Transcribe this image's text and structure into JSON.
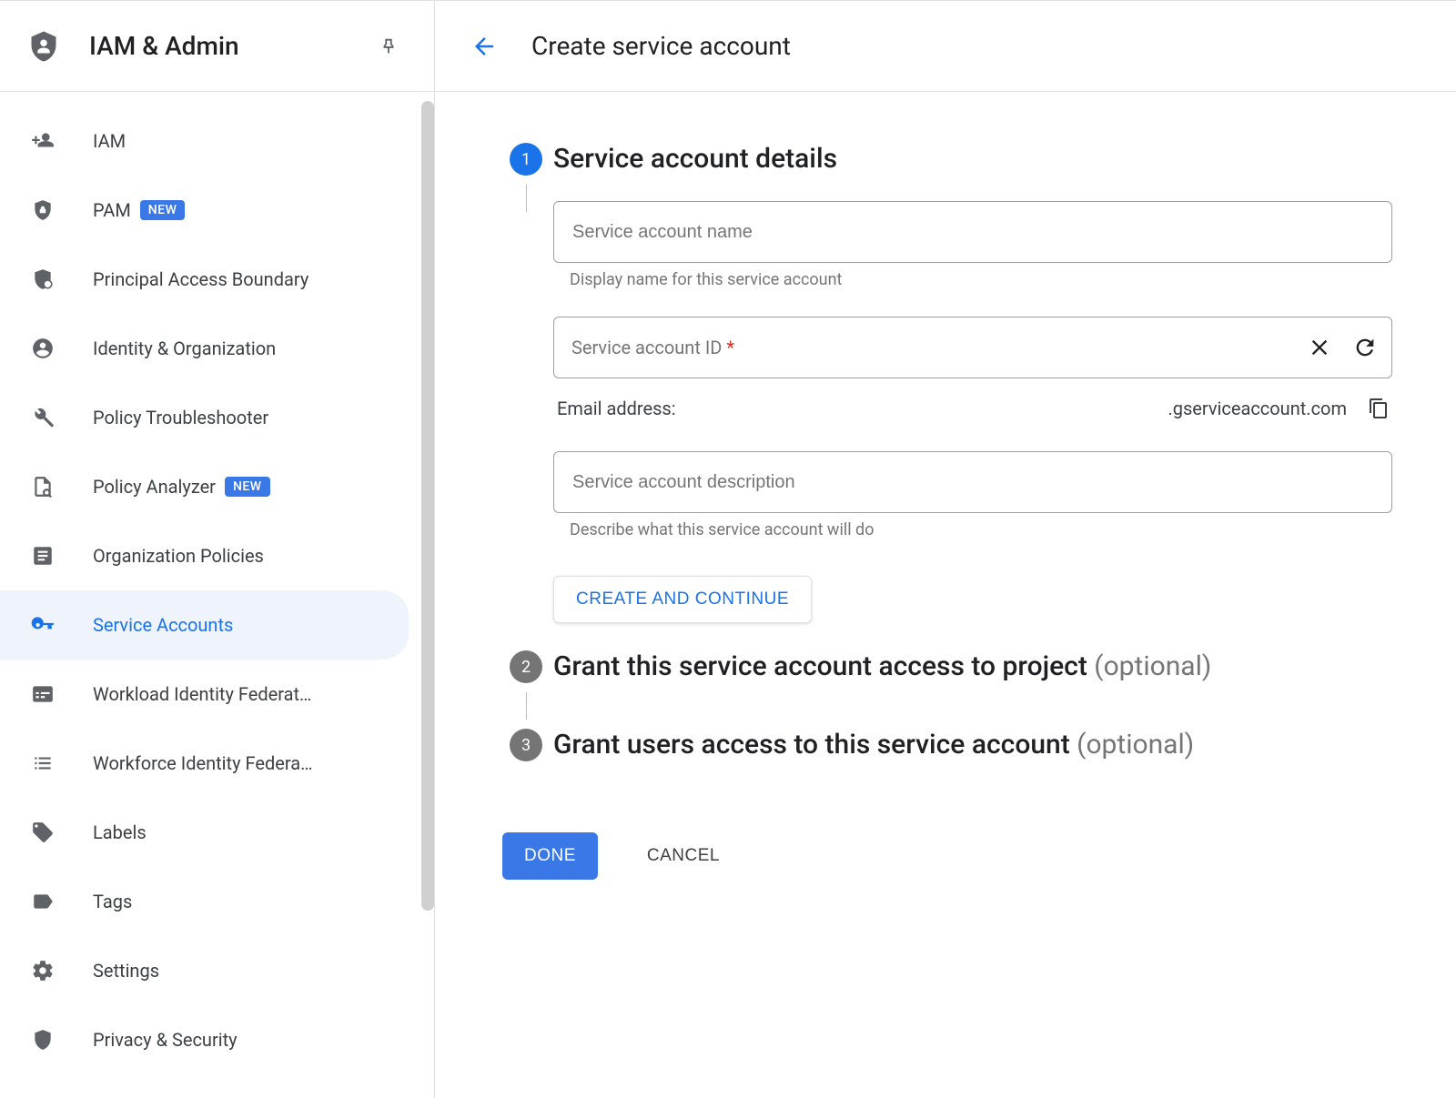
{
  "sidebar": {
    "product_title": "IAM & Admin",
    "items": [
      {
        "label": "IAM",
        "badge": null
      },
      {
        "label": "PAM",
        "badge": "NEW"
      },
      {
        "label": "Principal Access Boundary",
        "badge": null
      },
      {
        "label": "Identity & Organization",
        "badge": null
      },
      {
        "label": "Policy Troubleshooter",
        "badge": null
      },
      {
        "label": "Policy Analyzer",
        "badge": "NEW"
      },
      {
        "label": "Organization Policies",
        "badge": null
      },
      {
        "label": "Service Accounts",
        "badge": null
      },
      {
        "label": "Workload Identity Federat…",
        "badge": null
      },
      {
        "label": "Workforce Identity Federa…",
        "badge": null
      },
      {
        "label": "Labels",
        "badge": null
      },
      {
        "label": "Tags",
        "badge": null
      },
      {
        "label": "Settings",
        "badge": null
      },
      {
        "label": "Privacy & Security",
        "badge": null
      }
    ]
  },
  "header": {
    "page_title": "Create service account"
  },
  "steps": {
    "s1": {
      "number": "1",
      "title": "Service account details",
      "name_placeholder": "Service account name",
      "name_helper": "Display name for this service account",
      "id_placeholder": "Service account ID",
      "id_required_mark": "*",
      "email_label": "Email address:",
      "email_domain": ".gserviceaccount.com",
      "desc_placeholder": "Service account description",
      "desc_helper": "Describe what this service account will do",
      "create_continue": "CREATE AND CONTINUE"
    },
    "s2": {
      "number": "2",
      "title": "Grant this service account access to project ",
      "optional": "(optional)"
    },
    "s3": {
      "number": "3",
      "title": "Grant users access to this service account ",
      "optional": "(optional)"
    }
  },
  "buttons": {
    "done": "DONE",
    "cancel": "CANCEL"
  }
}
